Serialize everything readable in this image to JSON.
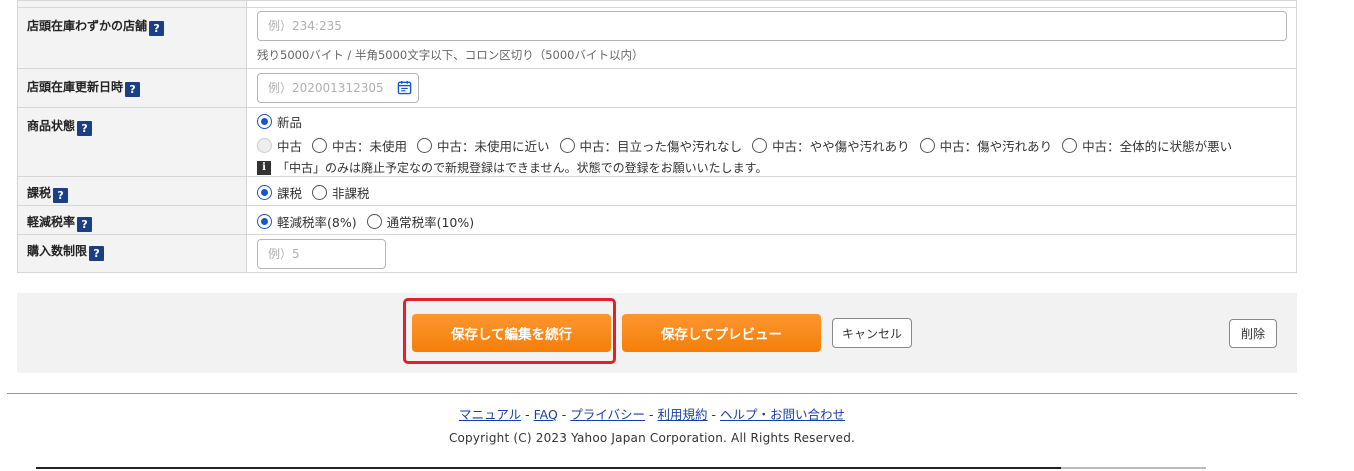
{
  "form": {
    "rows": {
      "shop_stock": {
        "label": "店頭在庫わずかの店舗",
        "placeholder": "例）234:235",
        "hint": "残り5000バイト / 半角5000文字以下、コロン区切り（5000バイト以内）"
      },
      "stock_updated": {
        "label": "店頭在庫更新日時",
        "placeholder": "例）202001312305"
      },
      "condition": {
        "label": "商品状態",
        "options": [
          "新品",
          "中古",
          "中古：未使用",
          "中古：未使用に近い",
          "中古：目立った傷や汚れなし",
          "中古：やや傷や汚れあり",
          "中古：傷や汚れあり",
          "中古：全体的に状態が悪い"
        ],
        "selected": "新品",
        "notice": "「中古」のみは廃止予定なので新規登録はできません。状態での登録をお願いいたします。"
      },
      "tax": {
        "label": "課税",
        "options": [
          "課税",
          "非課税"
        ],
        "selected": "課税"
      },
      "tax_rate": {
        "label": "軽減税率",
        "options": [
          "軽減税率(8%)",
          "通常税率(10%)"
        ],
        "selected": "軽減税率(8%)"
      },
      "purchase_limit": {
        "label": "購入数制限",
        "placeholder": "例）5"
      }
    },
    "help_glyph": "?",
    "info_glyph": "i"
  },
  "actions": {
    "save_continue": "保存して編集を続行",
    "save_preview": "保存してプレビュー",
    "cancel": "キャンセル",
    "delete": "削除"
  },
  "footer": {
    "links": [
      "マニュアル",
      "FAQ",
      "プライバシー",
      "利用規約",
      "ヘルプ・お問い合わせ"
    ],
    "separator": "-",
    "copyright": "Copyright (C) 2023 Yahoo Japan Corporation. All Rights Reserved."
  },
  "colors": {
    "accent_orange": "#fb8b1e",
    "highlight_red": "#e0202a",
    "help_icon_blue": "#1a3f86",
    "radio_blue": "#1a56c8"
  }
}
